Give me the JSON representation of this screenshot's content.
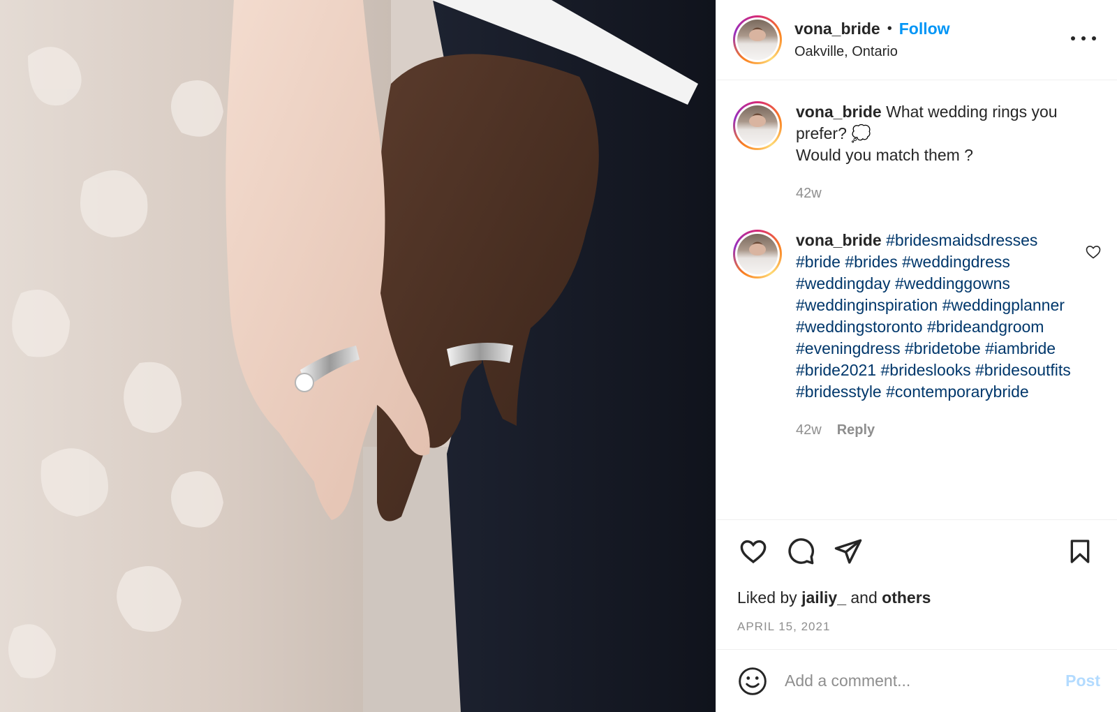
{
  "header": {
    "username": "vona_bride",
    "separator": "•",
    "follow_label": "Follow",
    "location": "Oakville, Ontario"
  },
  "caption": {
    "username": "vona_bride",
    "text_line1": "What wedding rings you prefer? 💭",
    "text_line2": "Would you match them ?",
    "age": "42w"
  },
  "comment": {
    "username": "vona_bride",
    "hashtags": "#bridesmaidsdresses #bride #brides #weddingdress #weddingday #weddinggowns #weddinginspiration #weddingplanner #weddingstoronto #brideandgroom #eveningdress #bridetobe #iambride #bride2021 #brideslooks #bridesoutfits #bridesstyle #contemporarybride",
    "age": "42w",
    "reply_label": "Reply"
  },
  "likes": {
    "prefix": "Liked by",
    "liker": "jailiy_",
    "and": "and",
    "others": "others"
  },
  "date": "APRIL 15, 2021",
  "comment_box": {
    "placeholder": "Add a comment...",
    "post_label": "Post"
  },
  "icons": {
    "like": "heart-icon",
    "comment": "comment-bubble-icon",
    "share": "paper-plane-icon",
    "save": "bookmark-icon",
    "emoji": "smiley-icon",
    "more": "more-horizontal-icon"
  },
  "colors": {
    "accent": "#0095f6",
    "hashtag": "#00376b",
    "muted": "#8e8e8e",
    "post_disabled": "#b3dbff"
  }
}
